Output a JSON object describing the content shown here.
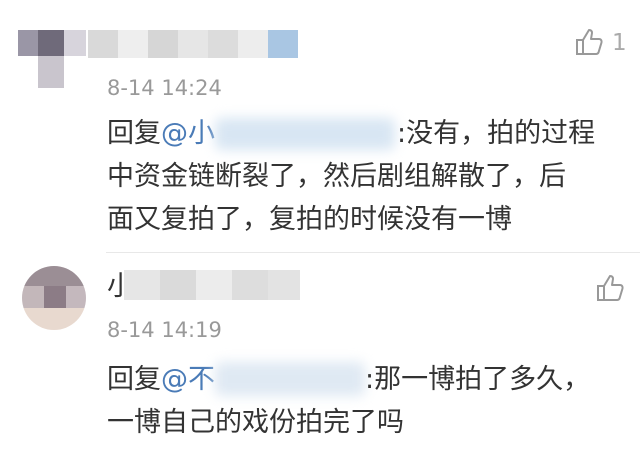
{
  "comments": [
    {
      "username_prefix": "",
      "timestamp": "8-14 14:24",
      "like_count": "1",
      "reply_label": "回复",
      "mention_prefix": "@小",
      "lines": [
        ":没有，拍的过程",
        "中资金链断裂了，然后剧组解散了，后",
        "面又复拍了，复拍的时候没有一博"
      ]
    },
    {
      "username_prefix": "小",
      "timestamp": "8-14 14:19",
      "like_count": "",
      "reply_label": "回复",
      "mention_prefix": "@不",
      "lines": [
        ":那一博拍了多久，",
        "一博自己的戏份拍完了吗"
      ]
    }
  ],
  "icons": {
    "like": "thumbs-up-icon"
  },
  "colors": {
    "link": "#4a7bb7",
    "text": "#333333",
    "meta": "#999999"
  }
}
